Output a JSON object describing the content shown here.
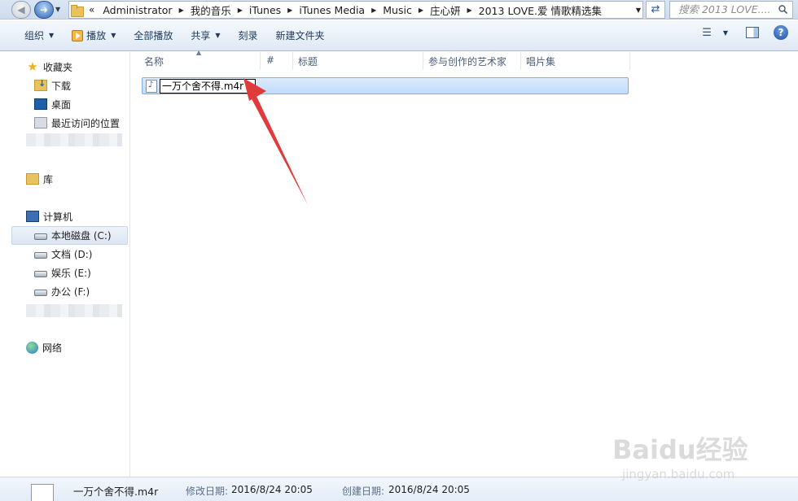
{
  "address_bar": {
    "overflow": "«",
    "crumbs": [
      "Administrator",
      "我的音乐",
      "iTunes",
      "iTunes Media",
      "Music",
      "庄心妍",
      "2013 LOVE.爱 情歌精选集"
    ],
    "search_placeholder": "搜索 2013 LOVE...."
  },
  "toolbar": {
    "organize": "组织",
    "play": "播放",
    "play_all": "全部播放",
    "share": "共享",
    "burn": "刻录",
    "new_folder": "新建文件夹"
  },
  "nav": {
    "favorites": "收藏夹",
    "downloads": "下载",
    "desktop": "桌面",
    "recent": "最近访问的位置",
    "libraries": "库",
    "computer": "计算机",
    "drive_c": "本地磁盘 (C:)",
    "drive_d": "文档 (D:)",
    "drive_e": "娱乐 (E:)",
    "drive_f": "办公 (F:)",
    "network": "网络"
  },
  "columns": {
    "name": "名称",
    "number": "#",
    "title": "标题",
    "artists": "参与创作的艺术家",
    "album": "唱片集"
  },
  "file": {
    "rename_value": "一万个舍不得.m4r"
  },
  "details": {
    "name": "一万个舍不得.m4r",
    "modified_label": "修改日期:",
    "modified_value": "2016/8/24 20:05",
    "created_label": "创建日期:",
    "created_value": "2016/8/24 20:05"
  },
  "watermark": {
    "text": "Baidu经验",
    "sub": "jingyan.baidu.com"
  },
  "colors": {
    "selection": "#c1dcfc",
    "annotation_arrow": "#e03a3a"
  }
}
